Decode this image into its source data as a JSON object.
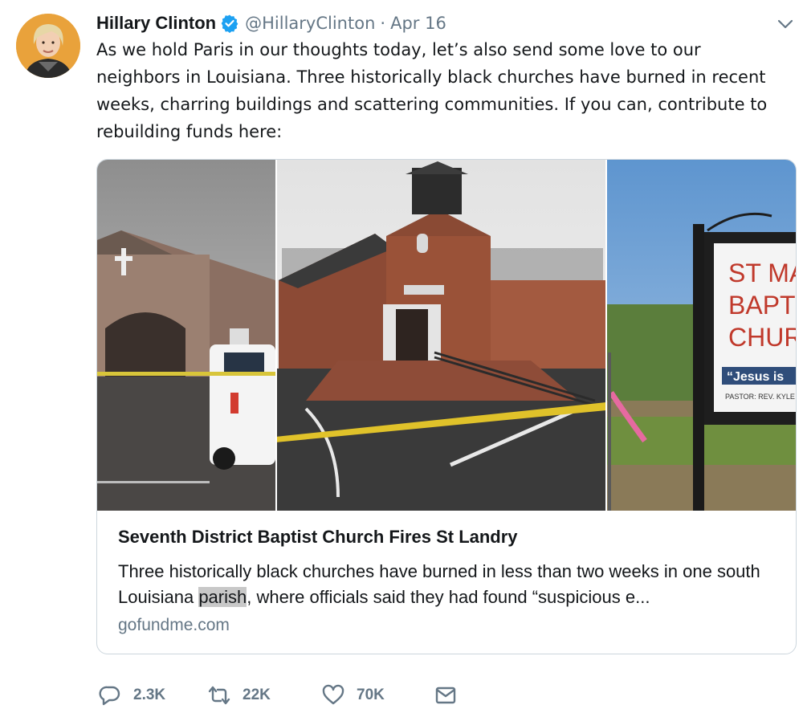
{
  "author": {
    "name": "Hillary Clinton",
    "handle": "@HillaryClinton",
    "separator": "·",
    "date": "Apr 16"
  },
  "icons": {
    "verified": "verified-badge-icon",
    "caret": "chevron-down-icon",
    "reply": "reply-icon",
    "retweet": "retweet-icon",
    "like": "heart-icon",
    "dm": "envelope-icon"
  },
  "colors": {
    "text": "#14171a",
    "muted": "#657786",
    "verified": "#1da1f2",
    "border": "#ccd6dd"
  },
  "tweet": {
    "text": "As we hold Paris in our thoughts today, let’s also send some love to our neighbors in Louisiana. Three historically black churches have burned in recent weeks, charring buildings and scattering communities. If you can, contribute to rebuilding funds here:"
  },
  "card": {
    "title": "Seventh District Baptist Church Fires St Landry",
    "desc_before": "Three historically black churches have burned in less than two weeks in one south Louisiana ",
    "desc_highlight": "parish",
    "desc_after": ", where officials said they had found “suspicious e...",
    "domain": "gofundme.com",
    "image_sign": {
      "line1": "ST MA",
      "line2": "BAPT",
      "line3": "CHUR",
      "motto": "“Jesus is",
      "pastor": "PASTOR: REV. KYLE T."
    }
  },
  "actions": {
    "replies": "2.3K",
    "retweets": "22K",
    "likes": "70K"
  }
}
